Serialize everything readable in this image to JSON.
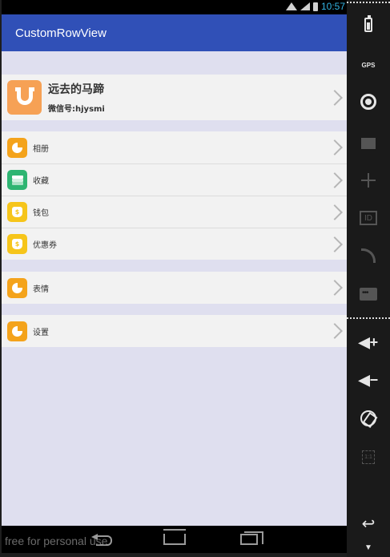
{
  "status_bar": {
    "time": "10:57"
  },
  "app_bar": {
    "title": "CustomRowView"
  },
  "profile": {
    "name": "远去的马蹄",
    "wechat_id": "微信号:hjysmi"
  },
  "group1": [
    {
      "label": "相册",
      "icon": "album-icon"
    },
    {
      "label": "收藏",
      "icon": "favorites-icon"
    },
    {
      "label": "钱包",
      "icon": "wallet-icon"
    },
    {
      "label": "优惠券",
      "icon": "coupon-icon"
    }
  ],
  "group2": [
    {
      "label": "表情",
      "icon": "emoji-icon"
    }
  ],
  "group3": [
    {
      "label": "设置",
      "icon": "settings-icon"
    }
  ],
  "icons": {
    "wallet_symbol": "$"
  },
  "colors": {
    "app_bar": "#3050b7",
    "background": "#dfdfef",
    "row": "#f2f2f2",
    "avatar": "#f6a155",
    "orange_icon": "#f4a31b",
    "green_icon": "#2eb572",
    "yellow_icon": "#f6c51a"
  },
  "side_panel": {
    "gps_label": "GPS",
    "id_label": "ID",
    "scale_label": "1:1"
  },
  "watermark": "free for personal use"
}
